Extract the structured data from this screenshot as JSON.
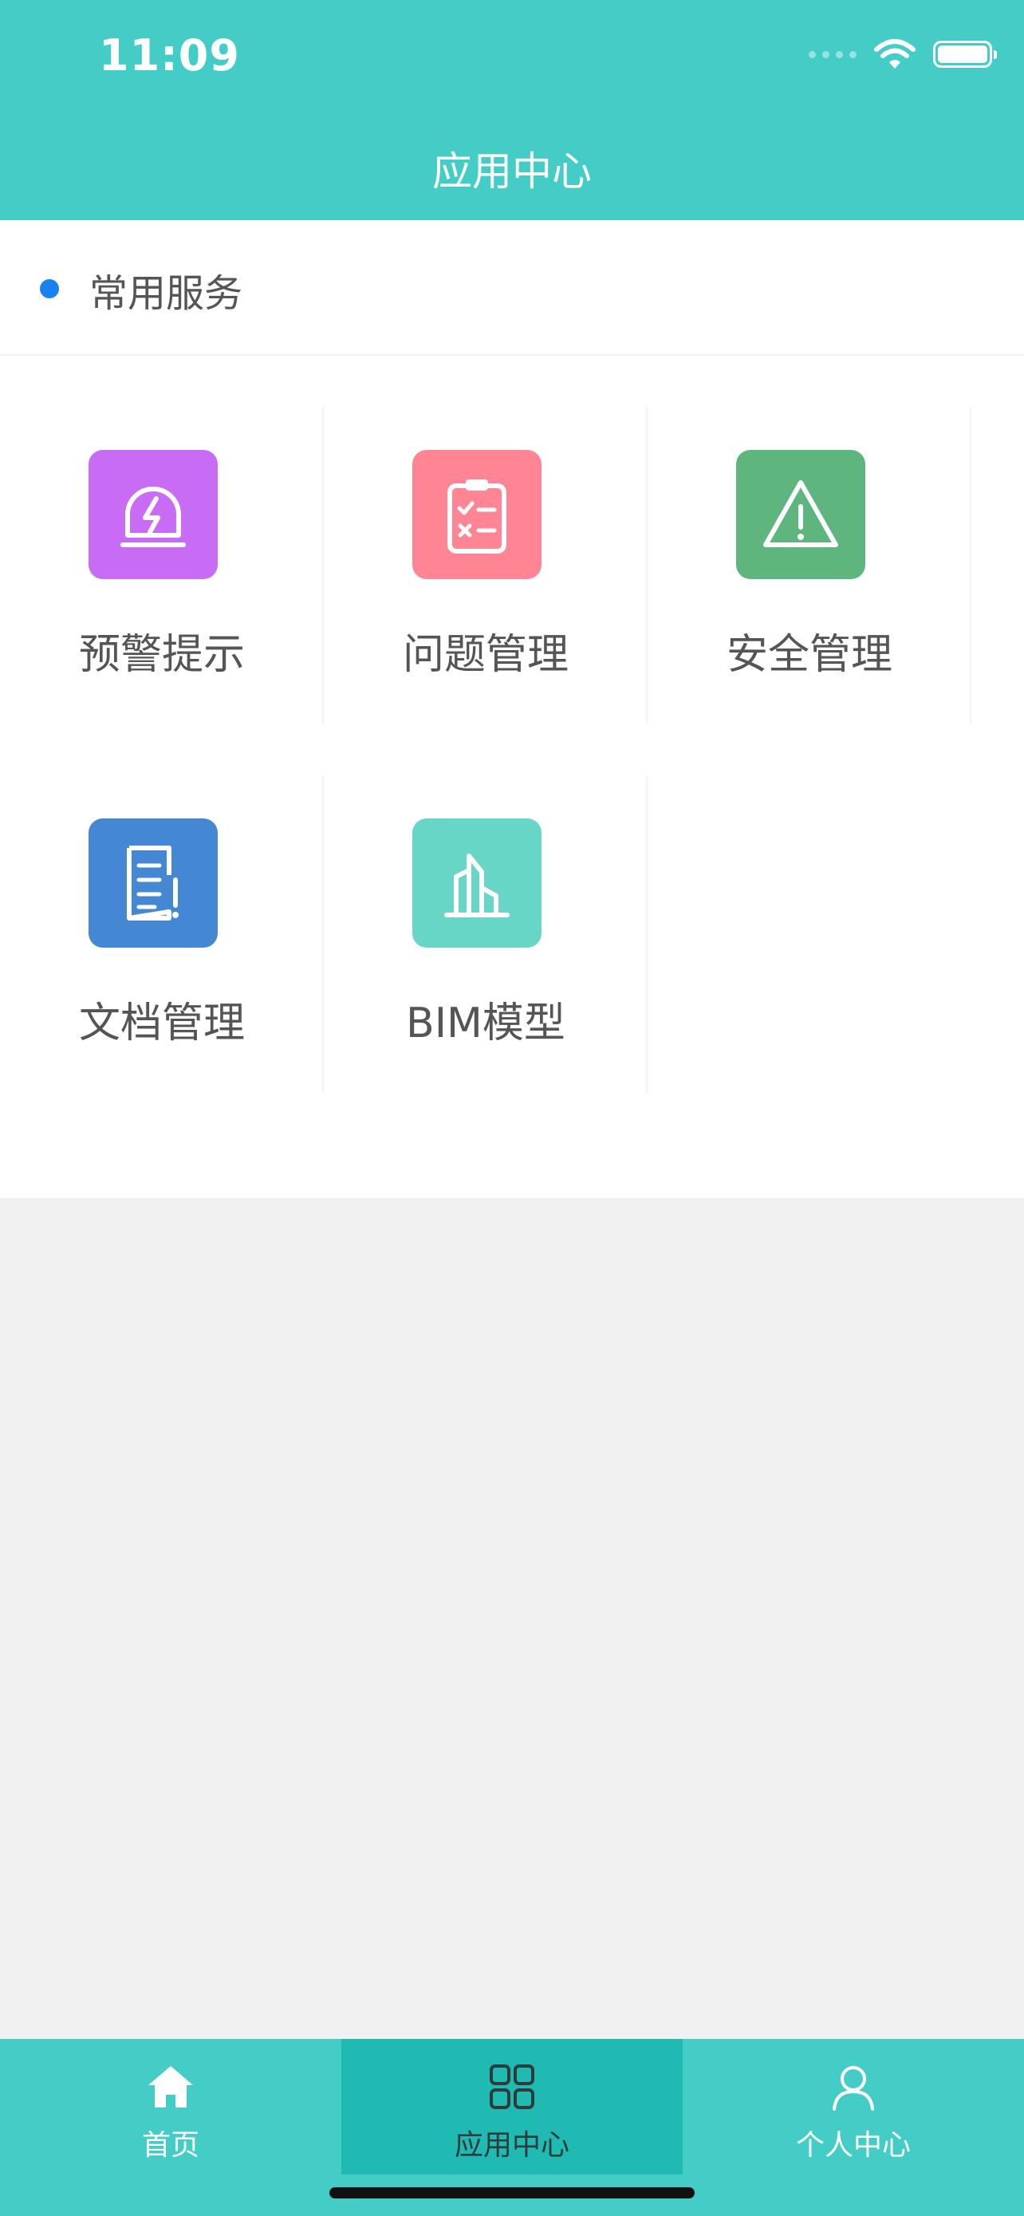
{
  "status_bar": {
    "time": "11:09"
  },
  "header": {
    "title": "应用中心"
  },
  "section": {
    "title": "常用服务"
  },
  "apps": [
    {
      "label": "预警提示",
      "icon": "warning-bell-icon",
      "color": "#c86cf5"
    },
    {
      "label": "问题管理",
      "icon": "clipboard-checklist-icon",
      "color": "#ff8595"
    },
    {
      "label": "安全管理",
      "icon": "triangle-alert-icon",
      "color": "#5fb57e"
    },
    {
      "label": "文档管理",
      "icon": "document-alert-icon",
      "color": "#4487d2"
    },
    {
      "label": "BIM模型",
      "icon": "building-icon",
      "color": "#68d6c6"
    }
  ],
  "tabbar": {
    "items": [
      {
        "label": "首页",
        "icon": "home-icon"
      },
      {
        "label": "应用中心",
        "icon": "grid-apps-icon",
        "active": true
      },
      {
        "label": "个人中心",
        "icon": "user-icon"
      }
    ]
  },
  "colors": {
    "header_bg": "#44cdc6",
    "tab_active_bg": "#1fbbb2",
    "section_dot": "#1a82f0"
  }
}
